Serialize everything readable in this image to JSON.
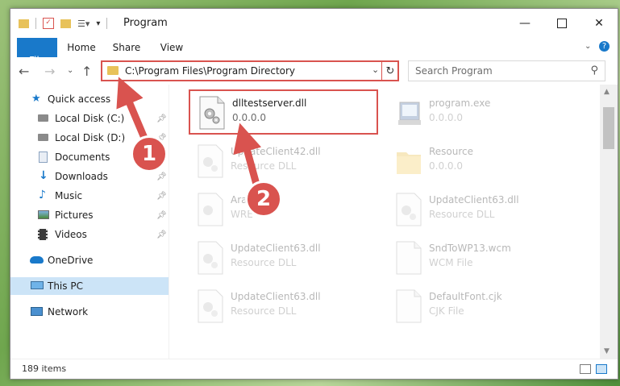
{
  "window": {
    "title": "Program",
    "minimize_icon": "minimize-icon",
    "maximize_icon": "maximize-icon",
    "close_icon": "close-icon"
  },
  "ribbon": {
    "tabs": [
      "File",
      "Home",
      "Share",
      "View"
    ],
    "expand_icon": "chevron-down-icon",
    "help_icon": "help-icon"
  },
  "navigation": {
    "back_icon": "back-arrow-icon",
    "forward_icon": "forward-arrow-icon",
    "recent_icon": "chevron-down-icon",
    "up_icon": "up-arrow-icon",
    "address": "C:\\Program Files\\Program Directory",
    "search_placeholder": "Search Program"
  },
  "sidebar": {
    "items": [
      {
        "label": "Quick access",
        "icon": "star-icon"
      },
      {
        "label": "Local Disk (C:)",
        "icon": "drive-icon",
        "pinned": true
      },
      {
        "label": "Local Disk (D:)",
        "icon": "drive-icon",
        "pinned": true
      },
      {
        "label": "Documents",
        "icon": "documents-icon",
        "pinned": true
      },
      {
        "label": "Downloads",
        "icon": "download-icon",
        "pinned": true
      },
      {
        "label": "Music",
        "icon": "music-icon",
        "pinned": true
      },
      {
        "label": "Pictures",
        "icon": "pictures-icon",
        "pinned": true
      },
      {
        "label": "Videos",
        "icon": "videos-icon",
        "pinned": true
      },
      {
        "label": "OneDrive",
        "icon": "cloud-icon"
      },
      {
        "label": "This PC",
        "icon": "computer-icon",
        "selected": true
      },
      {
        "label": "Network",
        "icon": "network-icon"
      }
    ]
  },
  "files": [
    {
      "name": "dlltestserver.dll",
      "sub": "0.0.0.0",
      "icon": "dll-file-icon",
      "highlighted": true
    },
    {
      "name": "program.exe",
      "sub": "0.0.0.0",
      "icon": "exe-file-icon"
    },
    {
      "name": "UpdateClient42.dll",
      "sub": "Resource DLL",
      "icon": "dll-file-icon"
    },
    {
      "name": "Resource",
      "sub": "0.0.0.0",
      "icon": "folder-icon"
    },
    {
      "name": "Arabic.dll",
      "sub": "WRE",
      "icon": "dll-file-icon"
    },
    {
      "name": "UpdateClient63.dll",
      "sub": "Resource DLL",
      "icon": "dll-file-icon"
    },
    {
      "name": "UpdateClient63.dll",
      "sub": "Resource DLL",
      "icon": "dll-file-icon"
    },
    {
      "name": "SndToWP13.wcm",
      "sub": "WCM File",
      "icon": "file-icon"
    },
    {
      "name": "UpdateClient63.dll",
      "sub": "Resource DLL",
      "icon": "dll-file-icon"
    },
    {
      "name": "DefaultFont.cjk",
      "sub": "CJK File",
      "icon": "file-icon"
    }
  ],
  "status": {
    "item_count": "189 items"
  },
  "callouts": [
    "1",
    "2"
  ],
  "colors": {
    "accent": "#1979ca",
    "highlight": "#d9534f",
    "selected": "#cce4f7"
  }
}
